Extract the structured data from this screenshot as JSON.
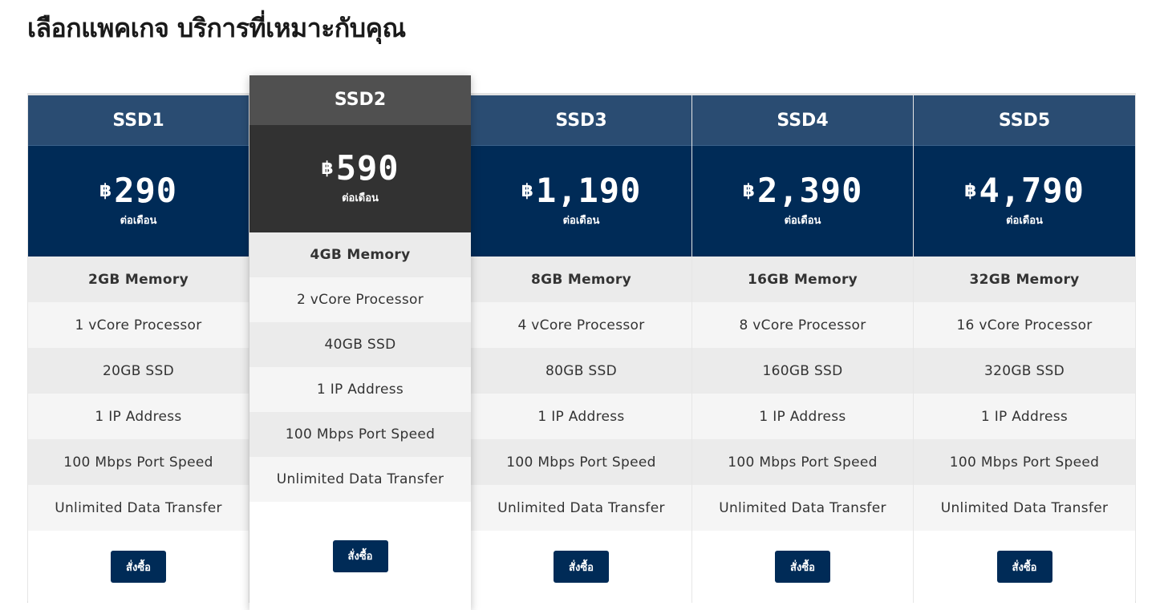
{
  "page": {
    "title": "เลือกแพคเกจ บริการที่เหมาะกับคุณ"
  },
  "colors": {
    "header": "#2a4c72",
    "price_bg": "#002b57",
    "featured_header": "#505050",
    "featured_price_bg": "#323232",
    "button": "#002b57"
  },
  "plans": [
    {
      "name": "SSD1",
      "currency": "฿",
      "price": "290",
      "period": "ต่อเดือน",
      "features": [
        "2GB Memory",
        "1 vCore Processor",
        "20GB SSD",
        "1 IP Address",
        "100 Mbps Port Speed",
        "Unlimited Data Transfer"
      ],
      "button": "สั่งซื้อ"
    },
    {
      "name": "SSD2",
      "currency": "฿",
      "price": "590",
      "period": "ต่อเดือน",
      "features": [
        "4GB Memory",
        "2 vCore Processor",
        "40GB SSD",
        "1 IP Address",
        "100 Mbps Port Speed",
        "Unlimited Data Transfer"
      ],
      "button": "สั่งซื้อ",
      "featured": true
    },
    {
      "name": "SSD3",
      "currency": "฿",
      "price": "1,190",
      "period": "ต่อเดือน",
      "features": [
        "8GB Memory",
        "4 vCore Processor",
        "80GB SSD",
        "1 IP Address",
        "100 Mbps Port Speed",
        "Unlimited Data Transfer"
      ],
      "button": "สั่งซื้อ"
    },
    {
      "name": "SSD4",
      "currency": "฿",
      "price": "2,390",
      "period": "ต่อเดือน",
      "features": [
        "16GB Memory",
        "8 vCore Processor",
        "160GB SSD",
        "1 IP Address",
        "100 Mbps Port Speed",
        "Unlimited Data Transfer"
      ],
      "button": "สั่งซื้อ"
    },
    {
      "name": "SSD5",
      "currency": "฿",
      "price": "4,790",
      "period": "ต่อเดือน",
      "features": [
        "32GB Memory",
        "16 vCore Processor",
        "320GB SSD",
        "1 IP Address",
        "100 Mbps Port Speed",
        "Unlimited Data Transfer"
      ],
      "button": "สั่งซื้อ"
    }
  ]
}
